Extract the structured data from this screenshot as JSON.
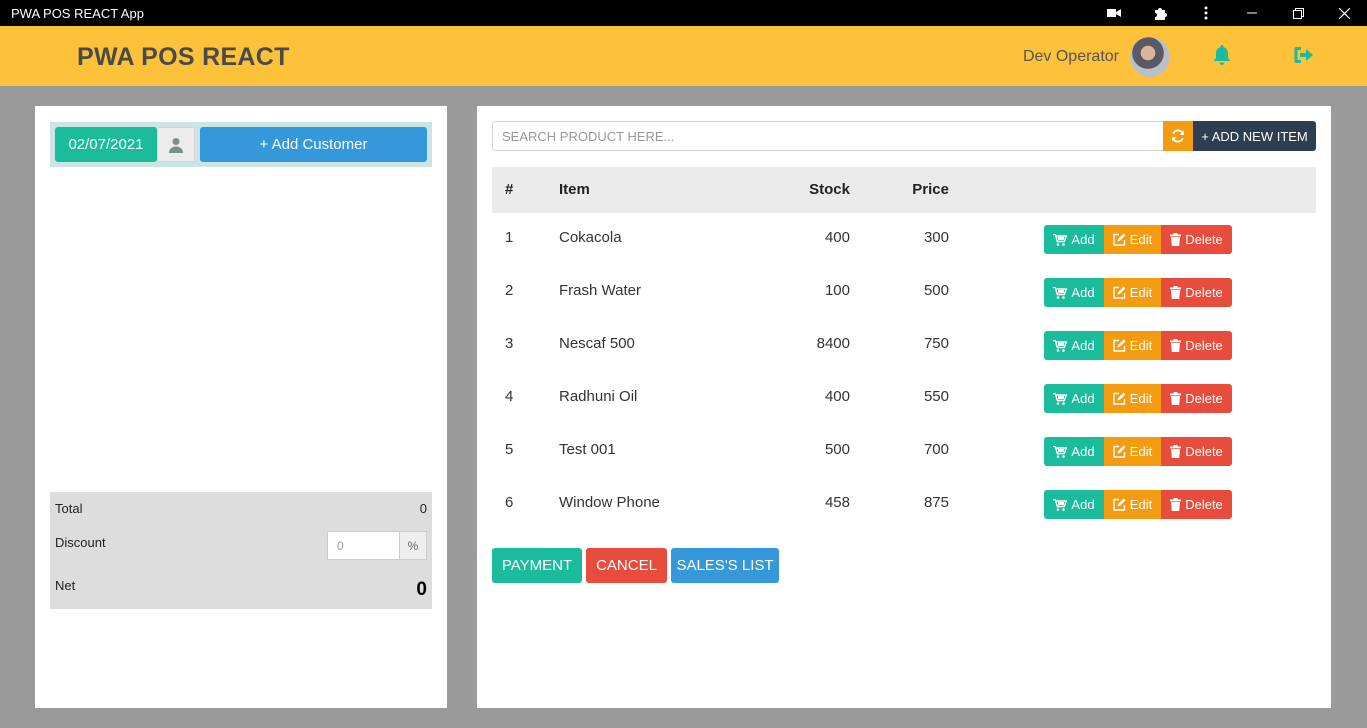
{
  "window": {
    "title": "PWA POS REACT App"
  },
  "header": {
    "brand": "PWA POS REACT",
    "operator": "Dev Operator"
  },
  "customer": {
    "date": "02/07/2021",
    "add_customer_label": "+ Add Customer"
  },
  "summary": {
    "total_label": "Total",
    "total_value": "0",
    "discount_label": "Discount",
    "discount_placeholder": "0",
    "discount_unit": "%",
    "net_label": "Net",
    "net_value": "0"
  },
  "products": {
    "search_placeholder": "SEARCH PRODUCT HERE...",
    "add_new_label": "+ ADD NEW ITEM",
    "columns": [
      "#",
      "Item",
      "Stock",
      "Price"
    ],
    "rows": [
      {
        "num": "1",
        "item": "Cokacola",
        "stock": "400",
        "price": "300"
      },
      {
        "num": "2",
        "item": "Frash Water",
        "stock": "100",
        "price": "500"
      },
      {
        "num": "3",
        "item": "Nescaf 500",
        "stock": "8400",
        "price": "750"
      },
      {
        "num": "4",
        "item": "Radhuni Oil",
        "stock": "400",
        "price": "550"
      },
      {
        "num": "5",
        "item": "Test 001",
        "stock": "500",
        "price": "700"
      },
      {
        "num": "6",
        "item": "Window Phone",
        "stock": "458",
        "price": "875"
      }
    ],
    "row_actions": {
      "add": "Add",
      "edit": "Edit",
      "delete": "Delete"
    }
  },
  "actions": {
    "payment": "PAYMENT",
    "cancel": "CANCEL",
    "sales_list": "SALES'S LIST"
  },
  "icons": {
    "camera": "camera-icon",
    "extensions": "puzzle-icon",
    "menu": "kebab-menu-icon",
    "user": "user-icon",
    "notifications": "bell-icon",
    "logout": "logout-icon",
    "refresh": "refresh-icon",
    "cart": "cart-icon",
    "edit": "edit-icon",
    "trash": "trash-icon"
  },
  "colors": {
    "header": "#fec13a",
    "primary": "#1abc9c",
    "warning": "#f39c12",
    "danger": "#e74c3c",
    "info": "#3498db",
    "dark": "#2c3e50"
  }
}
